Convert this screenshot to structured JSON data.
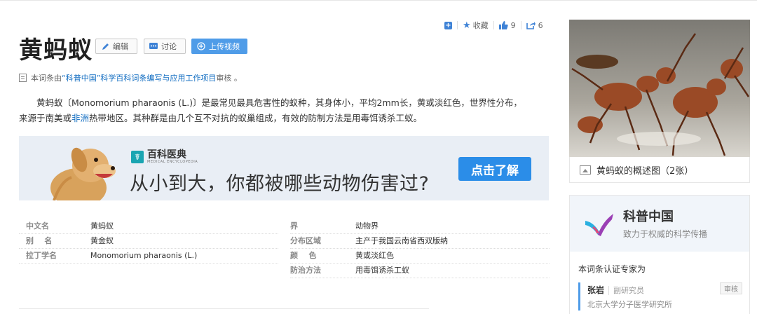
{
  "article": {
    "title": "黄蚂蚁",
    "edit_label": "编辑",
    "discuss_label": "讨论",
    "upload_label": "上传视频",
    "review_prefix": "本词条由",
    "review_link": "“科普中国”科学百科词条编写与应用工作项目",
    "review_suffix": " 审核 。",
    "summary_p1": "黄蚂蚁〔Monomorium pharaonis (L.)〕是最常见最具危害性的蚁种，其身体小，平均2mm长，黄或淡红色，世界性分布，",
    "summary_p2_before": "来源于南美或",
    "summary_p2_link": "非洲",
    "summary_p2_after": "热带地区。其种群是由几个互不对抗的蚁巢组成，有效的防制方法是用毒饵诱杀工蚁。"
  },
  "actions": {
    "collect_label": "收藏",
    "like_count": "9",
    "share_count": "6"
  },
  "banner": {
    "brand_name": "百科医典",
    "brand_sub": "MEDICAL ENCYCLOPEDIA",
    "headline": "从小到大，你都被哪些动物伤害过?",
    "cta_label": "点击了解"
  },
  "info": {
    "left": [
      {
        "key": "中文名",
        "value": "黄蚂蚁"
      },
      {
        "key": "别    名",
        "value": "黄金蚁"
      },
      {
        "key": "拉丁学名",
        "value": "Monomorium pharaonis (L.)"
      }
    ],
    "right": [
      {
        "key": "界",
        "value": "动物界"
      },
      {
        "key": "分布区域",
        "value": "主产于我国云南省西双版纳"
      },
      {
        "key": "颜    色",
        "value": "黄或淡红色"
      },
      {
        "key": "防治方法",
        "value": "用毒饵诱杀工蚁"
      }
    ]
  },
  "sidebar": {
    "photo_caption": "黄蚂蚁的概述图（2张）",
    "org_name": "科普中国",
    "org_slogan": "致力于权威的科学传播",
    "expert_title": "本词条认证专家为",
    "expert_name": "张岩",
    "expert_rank": "副研究员",
    "expert_org": "北京大学分子医学研究所",
    "expert_tag": "审核"
  },
  "colors": {
    "accent": "#4f9ce8",
    "link": "#136ec2",
    "cta": "#2b8de8",
    "banner_bg": "#e9eef5"
  }
}
